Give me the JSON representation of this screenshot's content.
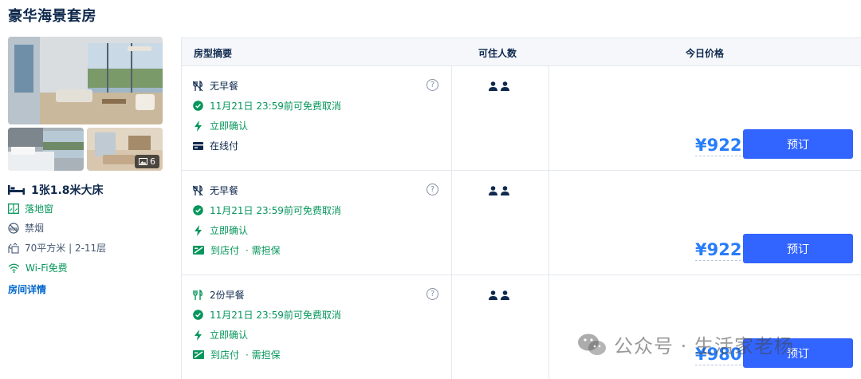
{
  "room": {
    "title": "豪华海景套房",
    "photo_count": "6",
    "bed": "1张1.8米大床",
    "features": [
      {
        "icon": "window-icon",
        "label": "落地窗",
        "highlight": true
      },
      {
        "icon": "no-smoking-icon",
        "label": "禁烟",
        "highlight": false
      },
      {
        "icon": "area-icon",
        "label": "70平方米 | 2-11层",
        "highlight": false
      },
      {
        "icon": "wifi-icon",
        "label": "Wi-Fi免费",
        "highlight": true
      }
    ],
    "details_link": "房间详情"
  },
  "table": {
    "headers": {
      "summary": "房型摘要",
      "occupancy": "可住人数",
      "price": "今日价格"
    },
    "help_glyph": "?",
    "rows": [
      {
        "meal": "无早餐",
        "meal_icon": "fork-knife-off-icon",
        "cancel": "11月21日 23:59前可免费取消",
        "confirm": "立即确认",
        "payment": "在线付",
        "payment_extra": "",
        "payment_icon": "card-icon",
        "guests": 2,
        "price": "¥922",
        "book_label": "预订"
      },
      {
        "meal": "无早餐",
        "meal_icon": "fork-knife-off-icon",
        "cancel": "11月21日 23:59前可免费取消",
        "confirm": "立即确认",
        "payment": "到店付",
        "payment_extra": " · 需担保",
        "payment_icon": "pay-at-hotel-icon",
        "guests": 2,
        "price": "¥922",
        "book_label": "预订"
      },
      {
        "meal": "2份早餐",
        "meal_icon": "fork-knife-icon",
        "cancel": "11月21日 23:59前可免费取消",
        "confirm": "立即确认",
        "payment": "到店付",
        "payment_extra": " · 需担保",
        "payment_icon": "pay-at-hotel-icon",
        "guests": 2,
        "price": "¥980",
        "book_label": "预订"
      }
    ]
  },
  "watermark": "公众号 · 生活家老杨",
  "colors": {
    "accent": "#287dfa",
    "button": "#3264ff",
    "green": "#06965b",
    "text": "#0f294d"
  }
}
